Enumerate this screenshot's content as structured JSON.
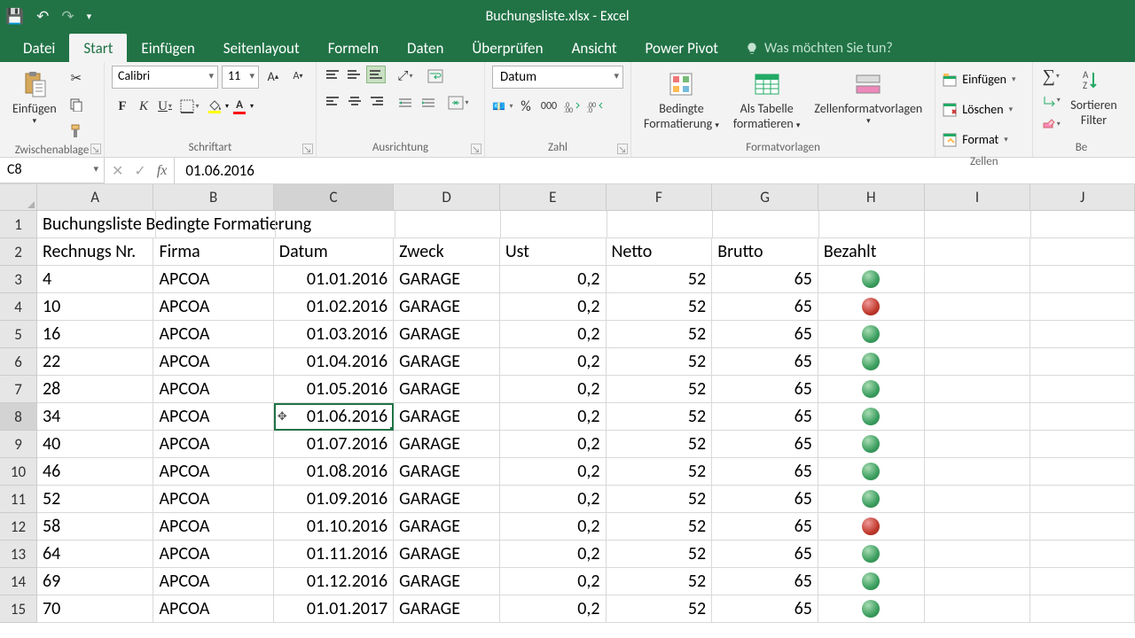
{
  "titlebar": {
    "title": "Buchungsliste.xlsx - Excel"
  },
  "tabs": {
    "datei": "Datei",
    "start": "Start",
    "einfuegen": "Einfügen",
    "seitenlayout": "Seitenlayout",
    "formeln": "Formeln",
    "daten": "Daten",
    "ueberpruefen": "Überprüfen",
    "ansicht": "Ansicht",
    "powerpivot": "Power Pivot",
    "tellme": "Was möchten Sie tun?"
  },
  "ribbon": {
    "clipboard": {
      "label": "Zwischenablage",
      "paste": "Einfügen"
    },
    "font": {
      "label": "Schriftart",
      "name": "Calibri",
      "size": "11"
    },
    "align": {
      "label": "Ausrichtung"
    },
    "number": {
      "label": "Zahl",
      "format": "Datum",
      "thousand": "000"
    },
    "styles": {
      "label": "Formatvorlagen",
      "conditional": "Bedingte",
      "conditional2": "Formatierung",
      "astable": "Als Tabelle",
      "astable2": "formatieren",
      "cellstyles": "Zellenformatvorlagen"
    },
    "cells": {
      "label": "Zellen",
      "insert": "Einfügen",
      "delete": "Löschen",
      "format": "Format"
    },
    "editing": {
      "label": "Be",
      "sort": "Sortieren",
      "filter": "Filter"
    }
  },
  "fbar": {
    "ref": "C8",
    "value": "01.06.2016"
  },
  "grid": {
    "col_widths": {
      "A": 134,
      "B": 138,
      "C": 138,
      "D": 122,
      "E": 122,
      "F": 122,
      "G": 122,
      "H": 122,
      "I": 122,
      "J": 120
    },
    "columns": [
      "A",
      "B",
      "C",
      "D",
      "E",
      "F",
      "G",
      "H",
      "I",
      "J"
    ],
    "selected_col": "C",
    "selected_row": 8,
    "rows_visible": [
      1,
      2,
      3,
      4,
      5,
      6,
      7,
      8,
      9,
      10,
      11,
      12,
      13,
      14,
      15
    ],
    "title_row": "Buchungsliste Bedingte Formatierung",
    "headers": {
      "A": "Rechnugs Nr.",
      "B": "Firma",
      "C": "Datum",
      "D": "Zweck",
      "E": "Ust",
      "F": "Netto",
      "G": "Brutto",
      "H": "Bezahlt"
    },
    "data": [
      {
        "nr": "4",
        "firma": "APCOA",
        "datum": "01.01.2016",
        "zweck": "GARAGE",
        "ust": "0,2",
        "netto": "52",
        "brutto": "65",
        "bez": "green"
      },
      {
        "nr": "10",
        "firma": "APCOA",
        "datum": "01.02.2016",
        "zweck": "GARAGE",
        "ust": "0,2",
        "netto": "52",
        "brutto": "65",
        "bez": "red"
      },
      {
        "nr": "16",
        "firma": "APCOA",
        "datum": "01.03.2016",
        "zweck": "GARAGE",
        "ust": "0,2",
        "netto": "52",
        "brutto": "65",
        "bez": "green"
      },
      {
        "nr": "22",
        "firma": "APCOA",
        "datum": "01.04.2016",
        "zweck": "GARAGE",
        "ust": "0,2",
        "netto": "52",
        "brutto": "65",
        "bez": "green"
      },
      {
        "nr": "28",
        "firma": "APCOA",
        "datum": "01.05.2016",
        "zweck": "GARAGE",
        "ust": "0,2",
        "netto": "52",
        "brutto": "65",
        "bez": "green"
      },
      {
        "nr": "34",
        "firma": "APCOA",
        "datum": "01.06.2016",
        "zweck": "GARAGE",
        "ust": "0,2",
        "netto": "52",
        "brutto": "65",
        "bez": "green"
      },
      {
        "nr": "40",
        "firma": "APCOA",
        "datum": "01.07.2016",
        "zweck": "GARAGE",
        "ust": "0,2",
        "netto": "52",
        "brutto": "65",
        "bez": "green"
      },
      {
        "nr": "46",
        "firma": "APCOA",
        "datum": "01.08.2016",
        "zweck": "GARAGE",
        "ust": "0,2",
        "netto": "52",
        "brutto": "65",
        "bez": "green"
      },
      {
        "nr": "52",
        "firma": "APCOA",
        "datum": "01.09.2016",
        "zweck": "GARAGE",
        "ust": "0,2",
        "netto": "52",
        "brutto": "65",
        "bez": "green"
      },
      {
        "nr": "58",
        "firma": "APCOA",
        "datum": "01.10.2016",
        "zweck": "GARAGE",
        "ust": "0,2",
        "netto": "52",
        "brutto": "65",
        "bez": "red"
      },
      {
        "nr": "64",
        "firma": "APCOA",
        "datum": "01.11.2016",
        "zweck": "GARAGE",
        "ust": "0,2",
        "netto": "52",
        "brutto": "65",
        "bez": "green"
      },
      {
        "nr": "69",
        "firma": "APCOA",
        "datum": "01.12.2016",
        "zweck": "GARAGE",
        "ust": "0,2",
        "netto": "52",
        "brutto": "65",
        "bez": "green"
      },
      {
        "nr": "70",
        "firma": "APCOA",
        "datum": "01.01.2017",
        "zweck": "GARAGE",
        "ust": "0,2",
        "netto": "52",
        "brutto": "65",
        "bez": "green"
      }
    ]
  }
}
